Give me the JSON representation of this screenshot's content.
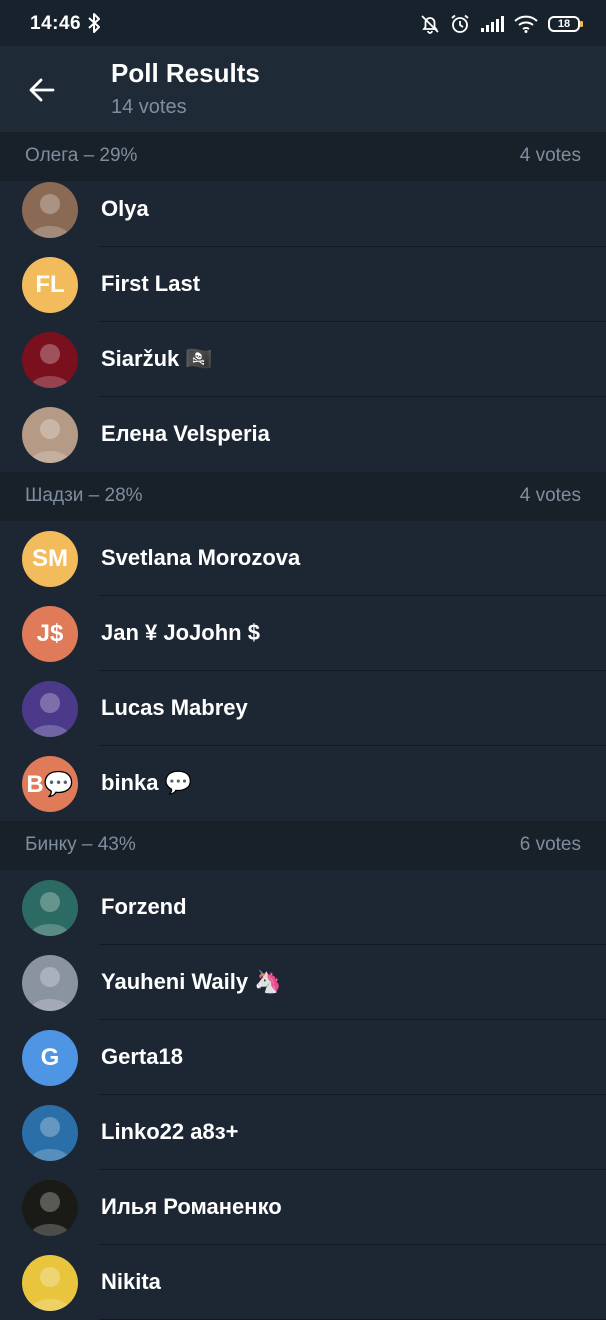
{
  "status_bar": {
    "time": "14:46",
    "battery": "18",
    "icons": [
      "bluetooth-icon",
      "bell-off-icon",
      "alarm-icon",
      "signal-icon",
      "wifi-icon",
      "battery-icon"
    ]
  },
  "header": {
    "title": "Poll Results",
    "subtitle": "14 votes",
    "back_icon": "back-arrow-icon"
  },
  "sections": [
    {
      "label": "Олега – 29%",
      "votes": "4 votes",
      "voters": [
        {
          "name": "Olya",
          "avatar_type": "photo",
          "avatar_color": "#8a6a55"
        },
        {
          "name": "First Last",
          "avatar_type": "initials",
          "initials": "FL",
          "avatar_color": "#f2bb5b"
        },
        {
          "name": "Siaržuk 🏴‍☠️",
          "avatar_type": "photo",
          "avatar_color": "#7a0f1e"
        },
        {
          "name": "Елена Velsperia",
          "avatar_type": "photo",
          "avatar_color": "#b59a86"
        }
      ]
    },
    {
      "label": "Шадзи – 28%",
      "votes": "4 votes",
      "voters": [
        {
          "name": "Svetlana Morozova",
          "avatar_type": "initials",
          "initials": "SM",
          "avatar_color": "#f2bb5b"
        },
        {
          "name": "Jan ¥ JoJohn $",
          "avatar_type": "initials",
          "initials": "J$",
          "avatar_color": "#e07b5a"
        },
        {
          "name": "Lucas Mabrey",
          "avatar_type": "photo",
          "avatar_color": "#4b3a8a"
        },
        {
          "name": "binka 💬",
          "avatar_type": "initials",
          "initials": "B💬",
          "avatar_color": "#e07b5a"
        }
      ]
    },
    {
      "label": "Бинку – 43%",
      "votes": "6 votes",
      "voters": [
        {
          "name": "Forzend",
          "avatar_type": "photo",
          "avatar_color": "#2c6b63"
        },
        {
          "name": "Yauheni Waily 🦄",
          "avatar_type": "photo",
          "avatar_color": "#8a93a0"
        },
        {
          "name": "Gerta18",
          "avatar_type": "initials",
          "initials": "G",
          "avatar_color": "#4e95e3"
        },
        {
          "name": "Linko22 a8з+",
          "avatar_type": "photo",
          "avatar_color": "#2a6fa8"
        },
        {
          "name": "Илья Романенко",
          "avatar_type": "photo",
          "avatar_color": "#1a1a16"
        },
        {
          "name": "Nikita",
          "avatar_type": "photo",
          "avatar_color": "#e8c53d"
        }
      ]
    }
  ]
}
